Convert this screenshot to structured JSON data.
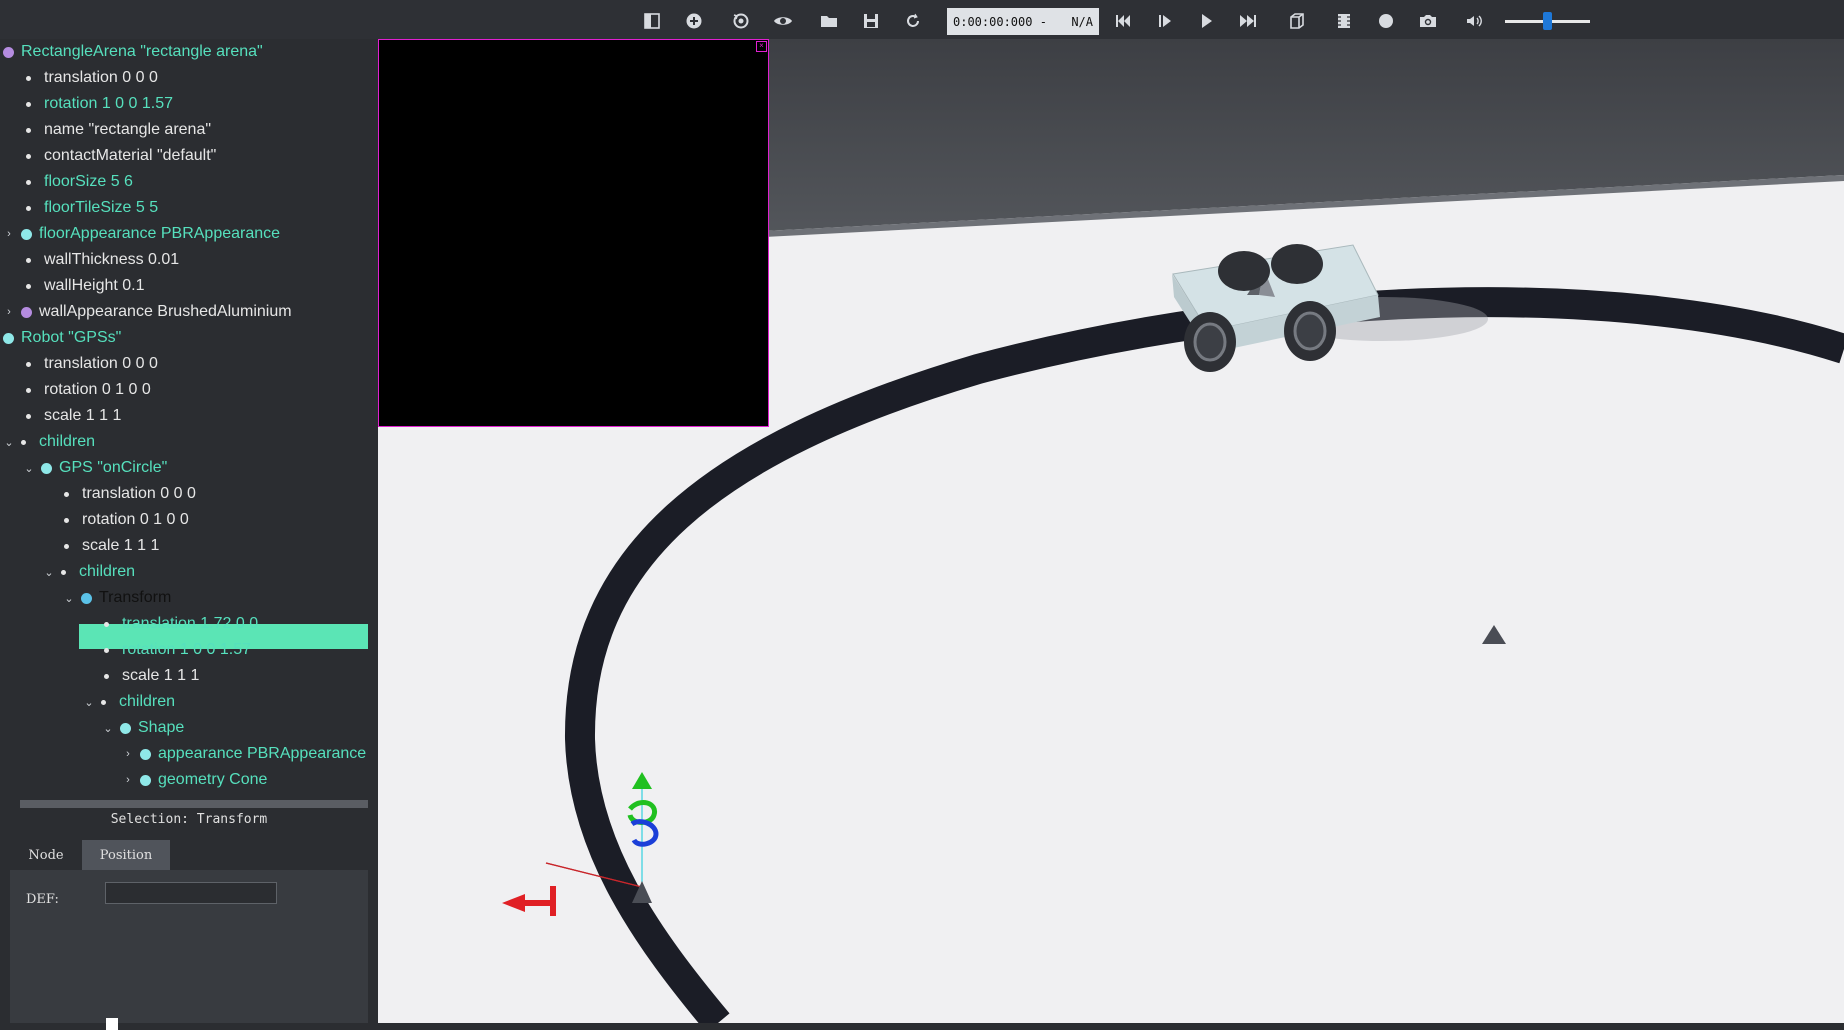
{
  "toolbar": {
    "buttons": [
      "toggle-scene-tree",
      "add-node",
      "reset-view",
      "view-options",
      "open-world",
      "save-world",
      "reload-world",
      "step-back",
      "step",
      "play",
      "fast-forward",
      "render-toggle",
      "record-movie",
      "record-circle",
      "screenshot",
      "sound"
    ],
    "time": "0:00:00:000 -",
    "speed": "N/A",
    "volume_level": 0.5
  },
  "scene_tree": {
    "rows": [
      {
        "label": "RectangleArena \"rectangle arena\"",
        "type": "node-purple"
      },
      {
        "label": "translation 0 0 0",
        "type": "field"
      },
      {
        "label": "rotation 1 0 0 1.57",
        "type": "field-mod"
      },
      {
        "label": "name \"rectangle arena\"",
        "type": "field"
      },
      {
        "label": "contactMaterial \"default\"",
        "type": "field"
      },
      {
        "label": "floorSize 5 6",
        "type": "field-mod"
      },
      {
        "label": "floorTileSize 5 5",
        "type": "field-mod"
      },
      {
        "label": "floorAppearance PBRAppearance",
        "type": "node-cyan"
      },
      {
        "label": "wallThickness 0.01",
        "type": "field"
      },
      {
        "label": "wallHeight 0.1",
        "type": "field"
      },
      {
        "label": "wallAppearance BrushedAluminium",
        "type": "node-purple"
      },
      {
        "label": "Robot \"GPSs\"",
        "type": "node-cyan"
      },
      {
        "label": "translation 0 0 0",
        "type": "field"
      },
      {
        "label": "rotation 0 1 0 0",
        "type": "field"
      },
      {
        "label": "scale 1 1 1",
        "type": "field"
      },
      {
        "label": "children",
        "type": "field-mod"
      },
      {
        "label": "GPS \"onCircle\"",
        "type": "node-cyan"
      },
      {
        "label": "translation 0 0 0",
        "type": "field"
      },
      {
        "label": "rotation 0 1 0 0",
        "type": "field"
      },
      {
        "label": "scale 1 1 1",
        "type": "field"
      },
      {
        "label": "children",
        "type": "field-mod"
      },
      {
        "label": "Transform",
        "type": "node-selected"
      },
      {
        "label": "translation 1.72 0 0",
        "type": "field-mod"
      },
      {
        "label": "rotation 1 0 0 1.57",
        "type": "field-mod"
      },
      {
        "label": "scale 1 1 1",
        "type": "field"
      },
      {
        "label": "children",
        "type": "field-mod"
      },
      {
        "label": "Shape",
        "type": "node-cyan"
      },
      {
        "label": "appearance PBRAppearance",
        "type": "node-cyan"
      },
      {
        "label": "geometry Cone",
        "type": "node-cyan"
      }
    ]
  },
  "properties": {
    "selection": "Selection: Transform",
    "tabs": [
      "Node",
      "Position"
    ],
    "active_tab": "Position",
    "def_label": "DEF:",
    "def_value": ""
  }
}
